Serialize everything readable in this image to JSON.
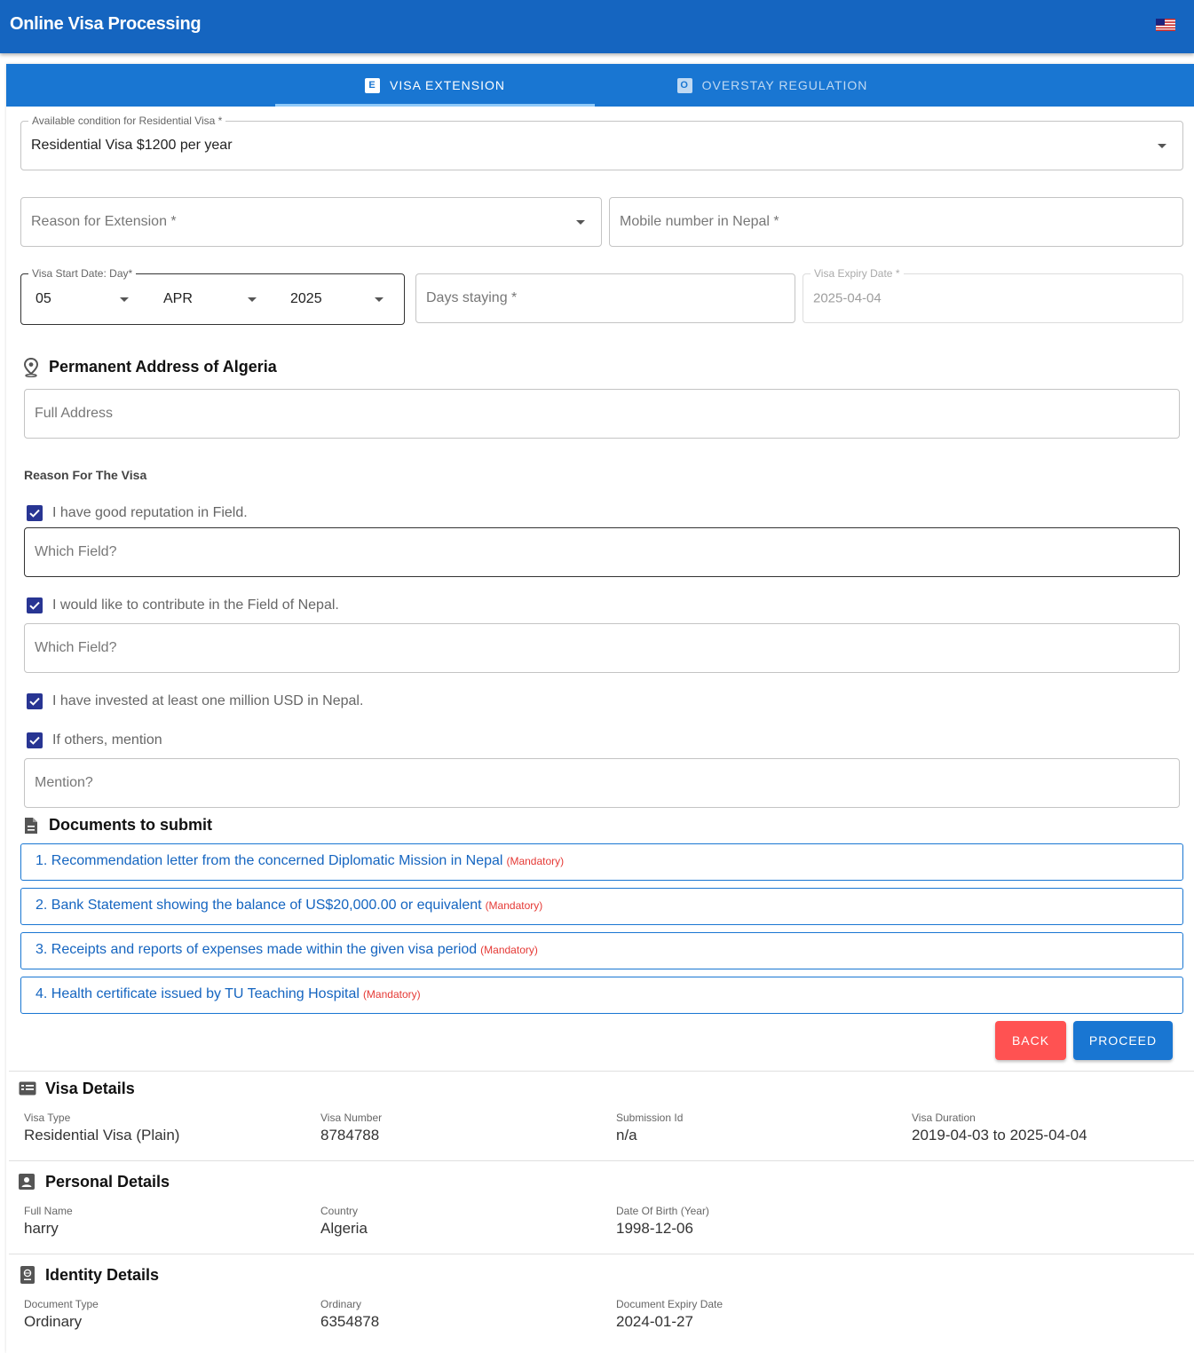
{
  "app": {
    "title": "Online Visa Processing",
    "flag_icon": "us-flag-icon"
  },
  "tabs": [
    {
      "icon_letter": "E",
      "label": "VISA EXTENSION"
    },
    {
      "icon_letter": "O",
      "label": "OVERSTAY REGULATION"
    }
  ],
  "form": {
    "condition": {
      "label": "Available condition for Residential Visa *",
      "value": "Residential Visa $1200 per year"
    },
    "reason_for_extension": {
      "placeholder": "Reason for Extension *"
    },
    "mobile_number": {
      "placeholder": "Mobile number in Nepal *"
    },
    "visa_start": {
      "label": "Visa Start Date: Day*",
      "day": "05",
      "month": "APR",
      "year": "2025"
    },
    "days_staying": {
      "placeholder": "Days staying *"
    },
    "visa_expiry": {
      "label": "Visa Expiry Date *",
      "value": "2025-04-04"
    },
    "address_section": {
      "title": "Permanent Address of Algeria",
      "placeholder": "Full Address"
    },
    "reason_for_visa": {
      "title": "Reason For The Visa",
      "options": [
        {
          "label": "I have good reputation in Field.",
          "checked": true,
          "input_placeholder": "Which Field?"
        },
        {
          "label": "I would like to contribute in the Field of Nepal.",
          "checked": true,
          "input_placeholder": "Which Field?"
        },
        {
          "label": "I have invested at least one million USD in Nepal.",
          "checked": true
        },
        {
          "label": "If others, mention",
          "checked": true,
          "input_placeholder": "Mention?"
        }
      ]
    }
  },
  "documents": {
    "title": "Documents to submit",
    "items": [
      {
        "text": "1. Recommendation letter from the concerned Diplomatic Mission in Nepal",
        "tag": "(Mandatory)"
      },
      {
        "text": "2. Bank Statement showing the balance of US$20,000.00 or equivalent",
        "tag": "(Mandatory)"
      },
      {
        "text": "3. Receipts and reports of expenses made within the given visa period",
        "tag": "(Mandatory)"
      },
      {
        "text": "4. Health certificate issued by TU Teaching Hospital",
        "tag": "(Mandatory)"
      }
    ]
  },
  "actions": {
    "back": "BACK",
    "proceed": "PROCEED"
  },
  "visa_details": {
    "title": "Visa Details",
    "fields": [
      {
        "label": "Visa Type",
        "value": "Residential Visa (Plain)"
      },
      {
        "label": "Visa Number",
        "value": "8784788"
      },
      {
        "label": "Submission Id",
        "value": "n/a"
      },
      {
        "label": "Visa Duration",
        "value": "2019-04-03 to 2025-04-04"
      }
    ]
  },
  "personal_details": {
    "title": "Personal Details",
    "fields": [
      {
        "label": "Full Name",
        "value": "harry"
      },
      {
        "label": "Country",
        "value": "Algeria"
      },
      {
        "label": "Date Of Birth (Year)",
        "value": "1998-12-06"
      }
    ]
  },
  "identity_details": {
    "title": "Identity Details",
    "fields": [
      {
        "label": "Document Type",
        "value": "Ordinary"
      },
      {
        "label": "Ordinary",
        "value": "6354878"
      },
      {
        "label": "Document Expiry Date",
        "value": "2024-01-27"
      }
    ]
  },
  "colors": {
    "appbar": "#1565c0",
    "tabbar": "#1976d2",
    "checkbox": "#283593",
    "back_button": "#ff5252",
    "mandatory": "#e53935"
  }
}
